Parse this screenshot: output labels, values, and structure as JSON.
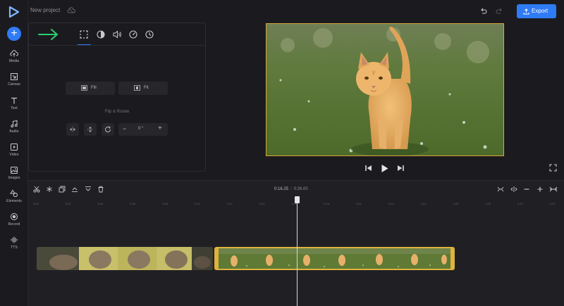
{
  "topbar": {
    "project_name": "New project",
    "export_label": "Export"
  },
  "sidebar": {
    "items": [
      {
        "label": "Media",
        "icon": "cloud-upload-icon"
      },
      {
        "label": "Canvas",
        "icon": "canvas-resize-icon"
      },
      {
        "label": "Text",
        "icon": "text-icon"
      },
      {
        "label": "Audio",
        "icon": "music-note-icon"
      },
      {
        "label": "Video",
        "icon": "video-play-icon"
      },
      {
        "label": "Images",
        "icon": "image-icon"
      },
      {
        "label": "Elements",
        "icon": "shapes-icon"
      },
      {
        "label": "Record",
        "icon": "record-icon"
      },
      {
        "label": "TTS",
        "icon": "waveform-icon"
      }
    ]
  },
  "panel": {
    "tabs": [
      "crop-frame-icon",
      "contrast-icon",
      "volume-icon",
      "speed-icon",
      "clock-icon"
    ],
    "fill_label": "Fill",
    "fit_label": "Fit",
    "flip_rotate_title": "Flip & Rotate",
    "rotation_value": "0 °"
  },
  "timeline": {
    "current_time": "0:16.25",
    "separator": "/",
    "total_time": "0:26.00",
    "ticks": [
      "0:00",
      "0:02",
      "0:04",
      "0:06",
      "0:08",
      "0:10",
      "0:12",
      "0:14",
      "0:16",
      "0:18",
      "0:20",
      "0:22",
      "0:24",
      "0:26",
      "0:28",
      "0:30",
      "0:32"
    ],
    "playhead_time_s": 16.25
  },
  "colors": {
    "accent": "#2f7bf5",
    "clip_selected": "#e0b23e",
    "arrow": "#2ecc71"
  }
}
